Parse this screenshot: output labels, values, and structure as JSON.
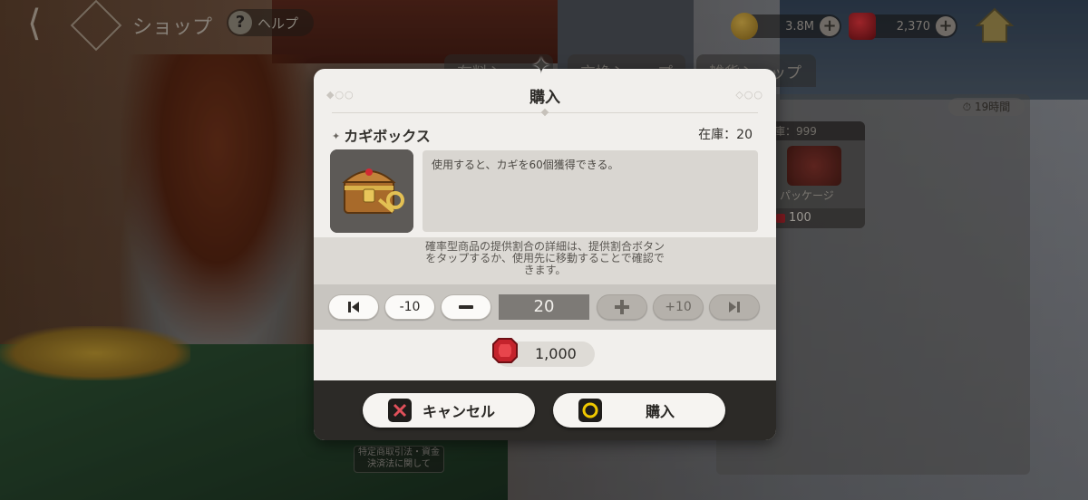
{
  "hud": {
    "title": "ショップ",
    "help_label": "ヘルプ",
    "gold_amount": "3.8M",
    "gem_amount": "2,370"
  },
  "background": {
    "tabs": [
      "有料ショップ",
      "交換ショップ",
      "雑貨ショップ"
    ],
    "timer": "19時間",
    "card_stock": "庫：999",
    "card_name": "パッケージ",
    "card_price": "100",
    "notice": "特定商取引法・資金決済法に関して"
  },
  "modal": {
    "title": "購入",
    "item_name": "カギボックス",
    "stock_label": "在庫：20",
    "description": "使用すると、カギを60個獲得できる。",
    "info_line1": "確率型商品の提供割合の詳細は、提供割合ボタン",
    "info_line2": "をタップするか、使用先に移動することで確認で",
    "info_line3": "きます。",
    "qty_minus10": "-10",
    "qty_plus10": "+10",
    "quantity": "20",
    "price": "1,000",
    "cancel_label": "キャンセル",
    "buy_label": "購入"
  },
  "colors": {
    "modal_bg": "#f1efec",
    "footer_bg": "#2c2a27",
    "gem_red": "#c4232c",
    "buy_icon_ring": "#f0c800"
  }
}
